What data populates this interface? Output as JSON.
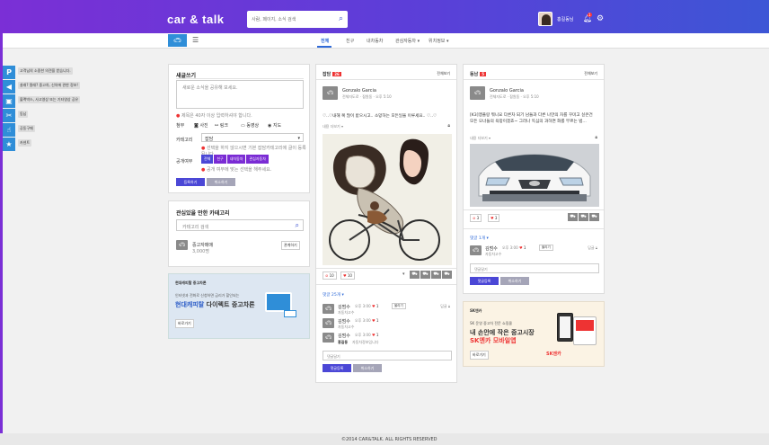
{
  "header": {
    "logo": "car & talk",
    "search_placeholder": "사람, 페이지, 소식 검색",
    "user_name": "홍길동님",
    "bell_count": "1"
  },
  "subnav": {
    "tabs": [
      "전체",
      "친구",
      "내차동차",
      "관심자동차 ▾",
      "위치정보 ▾"
    ]
  },
  "sidebar": [
    "고객님의 소중한 의견을 받습니다.",
    "살래? 팔래? 중고차, 신차에 관한 정보!",
    "블랙박스, 사고영상 또는 기타영상 공유",
    "동남",
    "공동구매",
    "카센트"
  ],
  "compose": {
    "title": "새글쓰기",
    "placeholder": "새로운 소식을 공유해 보세요.",
    "hint": "제목은 40자 이상 입력하셔야 합니다.",
    "attach_label": "첨부",
    "attach_items": [
      "사진",
      "링크",
      "동영상",
      "지도"
    ],
    "category_label": "카테고리",
    "category_value": "잡담",
    "category_note": "선택을 하지 않으시면 기본 잡담카테고리에 글이 등록됩니다.",
    "public_label": "공개여부",
    "public_opts": [
      "전체",
      "친구",
      "내차동차",
      "관심자동차"
    ],
    "public_note": "공개 여부에 맞는 선택을 해주세요.",
    "submit": "등록하기",
    "cancel": "취소하기"
  },
  "category": {
    "title": "관심있을 만한 카테고리",
    "search_placeholder": "카테고리 검색",
    "item_name": "중고자매매",
    "item_count": "3,000명",
    "join": "관계하기"
  },
  "ad1": {
    "label": "현대캐피탈 중고차론",
    "line1": "인터넷과 전화로 신청하면 금리가 할인되는",
    "line2a": "현대캐피탈",
    "line2b": "다이렉트 중고차론",
    "btn": "바로가기"
  },
  "feed1": {
    "tag_label": "잡담",
    "tag_count": "26",
    "view_all": "전체보기",
    "author": "Gonzalo Garcia",
    "meta": "전체자도로 · 잠원동 · 오후 5:10",
    "text": "♡..♡내해 복 많이 받으시고.. 소망하는 모든일을 이루세요.. ♡..♡",
    "more": "내용 더보기 ▾",
    "likes": "10",
    "hearts": "10",
    "comments_title": "댓글 25개 ▾",
    "comments": [
      {
        "name": "김범수",
        "time": "오후 3:00",
        "hearts": "1",
        "sub": "자동차고수",
        "reply": "답글"
      },
      {
        "name": "김범수",
        "time": "오후 3:00",
        "hearts": "1",
        "sub": "자동차고수",
        "reply": ""
      },
      {
        "name": "김범수",
        "time": "오후 3:00",
        "hearts": "1",
        "sub": "",
        "reply": "",
        "extra_name": "홍길동",
        "extra_text": "자동차정보입니다"
      }
    ],
    "comment_placeholder": "댓글달기",
    "submit": "댓글등록",
    "cancel": "취소하기"
  },
  "feed2": {
    "tag_label": "동남",
    "tag_count": "5",
    "view_all": "전체보기",
    "author": "Gonzalo Garcia",
    "meta": "전체자도로 · 잠원동 · 오후 5:10",
    "text": "[K3]맹플랑 뭐니요 다른차 되기 남들과 다른 나만의 차를 꾸미고 싶은건 모든 오너들의 욕망이겠죠~ 그러나 똑심의 과하면 화를 부르는 법...",
    "more": "내용 더보기 ▾",
    "likes": "3",
    "hearts": "3",
    "comments_title": "댓글 1개 ▾",
    "comment_name": "김범수",
    "comment_time": "오후 3:00",
    "comment_hearts": "1",
    "comment_sub": "자동차고수",
    "comment_reply": "답글",
    "comment_placeholder": "댓글달기",
    "submit": "댓글등록",
    "cancel": "취소하기"
  },
  "ad2": {
    "label": "SK엔카",
    "line1": "SK 운영 중고차 전문 쇼핑몰",
    "line2": "내 손안에 작은 중고시장",
    "line3": "SK엔카 모바일앱",
    "btn": "바로가기",
    "brand": "SK엔카"
  },
  "footer": "©2014 CAR&TALK. ALL RIGHTS RESERVED"
}
